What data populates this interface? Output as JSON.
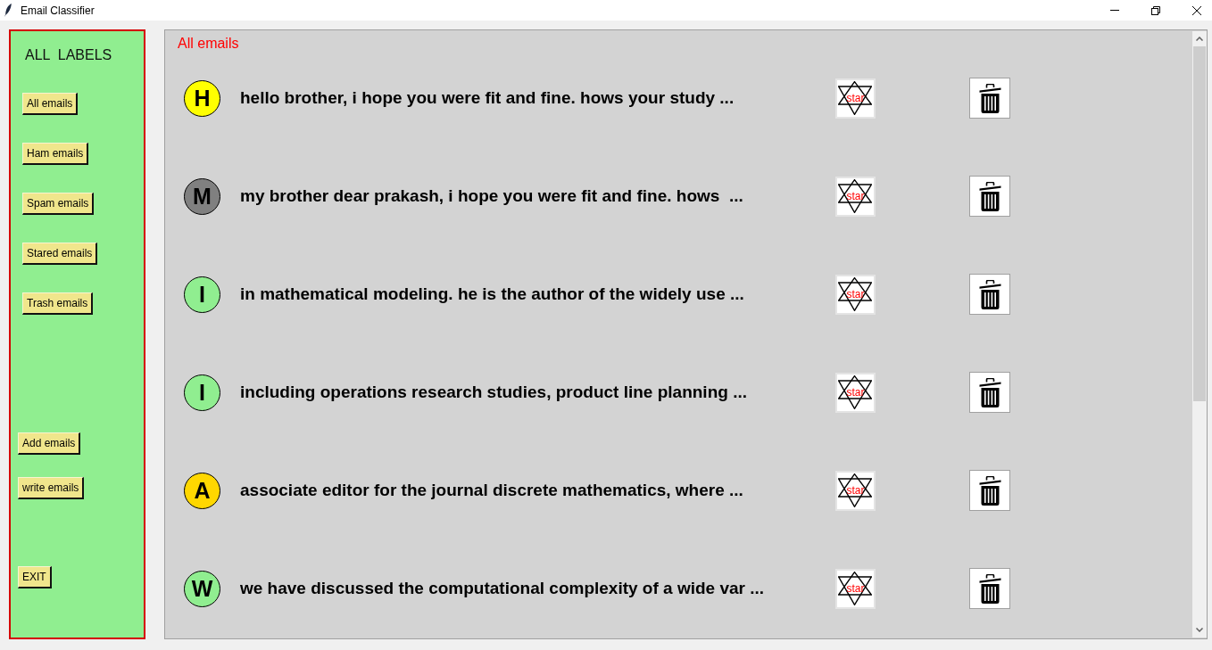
{
  "window": {
    "title": "Email Classifier"
  },
  "sidebar": {
    "title": "ALL  LABELS",
    "label_buttons": [
      "All emails",
      "Ham emails",
      "Spam emails",
      "Stared emails",
      "Trash emails"
    ],
    "action_buttons": [
      "Add emails",
      "write emails"
    ],
    "exit_button": "EXIT"
  },
  "main": {
    "heading": "All emails",
    "emails": [
      {
        "letter": "H",
        "color": "#ffff00",
        "preview": "hello brother, i hope you were fit and fine. hows your study ...",
        "star_button": "star"
      },
      {
        "letter": "M",
        "color": "#808080",
        "preview": "my brother dear prakash, i hope you were fit and fine. hows  ...",
        "star_button": "star"
      },
      {
        "letter": "I",
        "color": "#90ee90",
        "preview": "in mathematical modeling. he is the author of the widely use ...",
        "star_button": "star"
      },
      {
        "letter": "I",
        "color": "#90ee90",
        "preview": "including operations research studies, product line planning ...",
        "star_button": "star"
      },
      {
        "letter": "A",
        "color": "#ffd700",
        "preview": "associate editor for the journal discrete mathematics, where ...",
        "star_button": "star"
      },
      {
        "letter": "W",
        "color": "#90ee90",
        "preview": "we have discussed the computational complexity of a wide var ...",
        "star_button": "star"
      }
    ]
  }
}
